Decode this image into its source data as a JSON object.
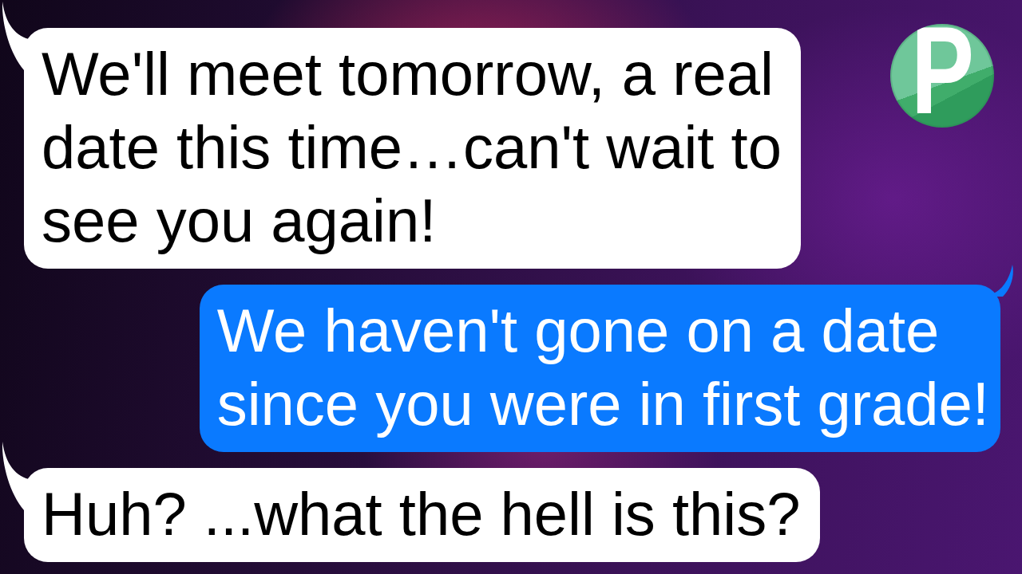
{
  "messages": [
    {
      "kind": "received",
      "text": "We'll meet tomorrow, a real\ndate this time…can't wait to\nsee you again!"
    },
    {
      "kind": "sent",
      "text": "We haven't gone on a date\nsince you were in first grade!"
    },
    {
      "kind": "received",
      "text": "Huh? ...what the hell is this?"
    }
  ],
  "logo": {
    "letter": "P"
  }
}
